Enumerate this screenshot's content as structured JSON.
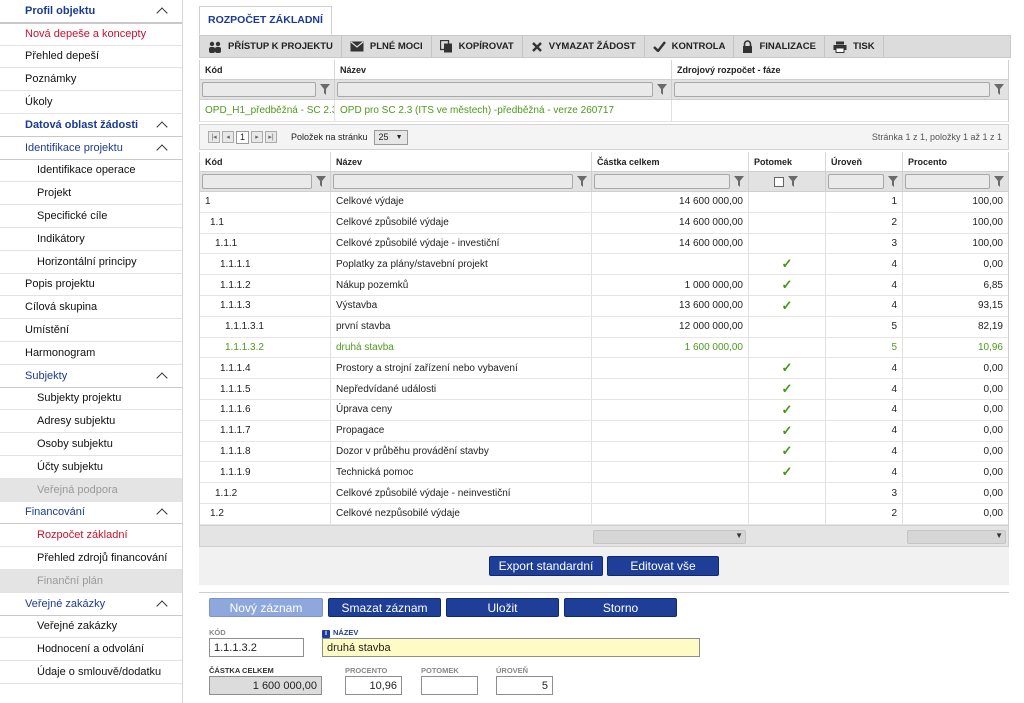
{
  "sidebar": {
    "items": [
      {
        "label": "Profil objektu",
        "type": "section"
      },
      {
        "label": "Nová depeše a koncepty",
        "type": "red"
      },
      {
        "label": "Přehled depeší",
        "type": "item"
      },
      {
        "label": "Poznámky",
        "type": "item"
      },
      {
        "label": "Úkoly",
        "type": "item"
      },
      {
        "label": "Datová oblast žádosti",
        "type": "section"
      },
      {
        "label": "Identifikace projektu",
        "type": "section-light"
      },
      {
        "label": "Identifikace operace",
        "type": "sub"
      },
      {
        "label": "Projekt",
        "type": "sub"
      },
      {
        "label": "Specifické cíle",
        "type": "sub"
      },
      {
        "label": "Indikátory",
        "type": "sub"
      },
      {
        "label": "Horizontální principy",
        "type": "sub"
      },
      {
        "label": "Popis projektu",
        "type": "item"
      },
      {
        "label": "Cílová skupina",
        "type": "item"
      },
      {
        "label": "Umístění",
        "type": "item"
      },
      {
        "label": "Harmonogram",
        "type": "item"
      },
      {
        "label": "Subjekty",
        "type": "section-light"
      },
      {
        "label": "Subjekty projektu",
        "type": "sub"
      },
      {
        "label": "Adresy subjektu",
        "type": "sub"
      },
      {
        "label": "Osoby subjektu",
        "type": "sub"
      },
      {
        "label": "Účty subjektu",
        "type": "sub"
      },
      {
        "label": "Veřejná podpora",
        "type": "sub-disabled"
      },
      {
        "label": "Financování",
        "type": "section-light"
      },
      {
        "label": "Rozpočet základní",
        "type": "sub-red"
      },
      {
        "label": "Přehled zdrojů financování",
        "type": "sub"
      },
      {
        "label": "Finanční plán",
        "type": "sub-disabled"
      },
      {
        "label": "Veřejné zakázky",
        "type": "section-light"
      },
      {
        "label": "Veřejné zakázky",
        "type": "sub"
      },
      {
        "label": "Hodnocení a odvolání",
        "type": "sub"
      },
      {
        "label": "Údaje o smlouvě/dodatku",
        "type": "sub"
      }
    ]
  },
  "tab": {
    "label": "ROZPOČET ZÁKLADNÍ"
  },
  "toolbar": {
    "buttons": [
      {
        "label": "PŘÍSTUP K PROJEKTU",
        "icon": "users-icon"
      },
      {
        "label": "PLNÉ MOCI",
        "icon": "envelope-icon"
      },
      {
        "label": "KOPÍROVAT",
        "icon": "copy-icon"
      },
      {
        "label": "VYMAZAT ŽÁDOST",
        "icon": "close-icon"
      },
      {
        "label": "KONTROLA",
        "icon": "check-icon"
      },
      {
        "label": "FINALIZACE",
        "icon": "lock-icon"
      },
      {
        "label": "TISK",
        "icon": "printer-icon"
      }
    ]
  },
  "top_grid": {
    "headers": [
      "Kód",
      "Název",
      "Zdrojový rozpočet - fáze"
    ],
    "row": {
      "kod": "OPD_H1_předběžná - SC 2.3...",
      "nazev": "OPD pro SC 2.3 (ITS ve městech) -předběžná - verze 260717",
      "faze": ""
    }
  },
  "pager": {
    "page": "1",
    "per_page_label": "Položek na stránku",
    "per_page": "25",
    "summary": "Stránka 1 z 1, položky 1 až 1 z 1"
  },
  "budget_grid": {
    "headers": [
      "Kód",
      "Název",
      "Částka celkem",
      "Potomek",
      "Úroveň",
      "Procento"
    ],
    "rows": [
      {
        "kod": "1",
        "indent": 0,
        "nazev": "Celkové výdaje",
        "castka": "14 600 000,00",
        "potomek": false,
        "uroven": "1",
        "procento": "100,00"
      },
      {
        "kod": "1.1",
        "indent": 1,
        "nazev": "Celkové způsobilé výdaje",
        "castka": "14 600 000,00",
        "potomek": false,
        "uroven": "2",
        "procento": "100,00"
      },
      {
        "kod": "1.1.1",
        "indent": 2,
        "nazev": "Celkové způsobilé výdaje - investiční",
        "castka": "14 600 000,00",
        "potomek": false,
        "uroven": "3",
        "procento": "100,00"
      },
      {
        "kod": "1.1.1.1",
        "indent": 3,
        "nazev": "Poplatky za plány/stavební projekt",
        "castka": "",
        "potomek": true,
        "uroven": "4",
        "procento": "0,00"
      },
      {
        "kod": "1.1.1.2",
        "indent": 3,
        "nazev": "Nákup pozemků",
        "castka": "1 000 000,00",
        "potomek": true,
        "uroven": "4",
        "procento": "6,85"
      },
      {
        "kod": "1.1.1.3",
        "indent": 3,
        "nazev": "Výstavba",
        "castka": "13 600 000,00",
        "potomek": true,
        "uroven": "4",
        "procento": "93,15"
      },
      {
        "kod": "1.1.1.3.1",
        "indent": 4,
        "nazev": "první stavba",
        "castka": "12 000 000,00",
        "potomek": false,
        "uroven": "5",
        "procento": "82,19"
      },
      {
        "kod": "1.1.1.3.2",
        "indent": 4,
        "nazev": "druhá stavba",
        "castka": "1 600 000,00",
        "potomek": false,
        "uroven": "5",
        "procento": "10,96",
        "selected": true
      },
      {
        "kod": "1.1.1.4",
        "indent": 3,
        "nazev": "Prostory a strojní zařízení nebo vybavení",
        "castka": "",
        "potomek": true,
        "uroven": "4",
        "procento": "0,00"
      },
      {
        "kod": "1.1.1.5",
        "indent": 3,
        "nazev": "Nepředvídané události",
        "castka": "",
        "potomek": true,
        "uroven": "4",
        "procento": "0,00"
      },
      {
        "kod": "1.1.1.6",
        "indent": 3,
        "nazev": "Úprava ceny",
        "castka": "",
        "potomek": true,
        "uroven": "4",
        "procento": "0,00"
      },
      {
        "kod": "1.1.1.7",
        "indent": 3,
        "nazev": "Propagace",
        "castka": "",
        "potomek": true,
        "uroven": "4",
        "procento": "0,00"
      },
      {
        "kod": "1.1.1.8",
        "indent": 3,
        "nazev": "Dozor v průběhu provádění stavby",
        "castka": "",
        "potomek": true,
        "uroven": "4",
        "procento": "0,00"
      },
      {
        "kod": "1.1.1.9",
        "indent": 3,
        "nazev": "Technická pomoc",
        "castka": "",
        "potomek": true,
        "uroven": "4",
        "procento": "0,00"
      },
      {
        "kod": "1.1.2",
        "indent": 2,
        "nazev": "Celkové způsobilé výdaje - neinvestiční",
        "castka": "",
        "potomek": false,
        "uroven": "3",
        "procento": "0,00"
      },
      {
        "kod": "1.2",
        "indent": 1,
        "nazev": "Celkové nezpůsobilé výdaje",
        "castka": "",
        "potomek": false,
        "uroven": "2",
        "procento": "0,00"
      }
    ]
  },
  "actions": {
    "export_label": "Export standardní",
    "edit_all_label": "Editovat vše",
    "new_label": "Nový záznam",
    "delete_label": "Smazat záznam",
    "save_label": "Uložit",
    "cancel_label": "Storno"
  },
  "form": {
    "kod_label": "KÓD",
    "kod_value": "1.1.1.3.2",
    "nazev_label": "NÁZEV",
    "nazev_value": "druhá stavba",
    "castka_label": "ČÁSTKA CELKEM",
    "castka_value": "1 600 000,00",
    "procento_label": "PROCENTO",
    "procento_value": "10,96",
    "potomek_label": "POTOMEK",
    "potomek_value": "",
    "uroven_label": "ÚROVEŇ",
    "uroven_value": "5"
  },
  "colors": {
    "accent": "#1e3e98",
    "link_red": "#c8102e",
    "selected_green": "#4d9a1c"
  }
}
